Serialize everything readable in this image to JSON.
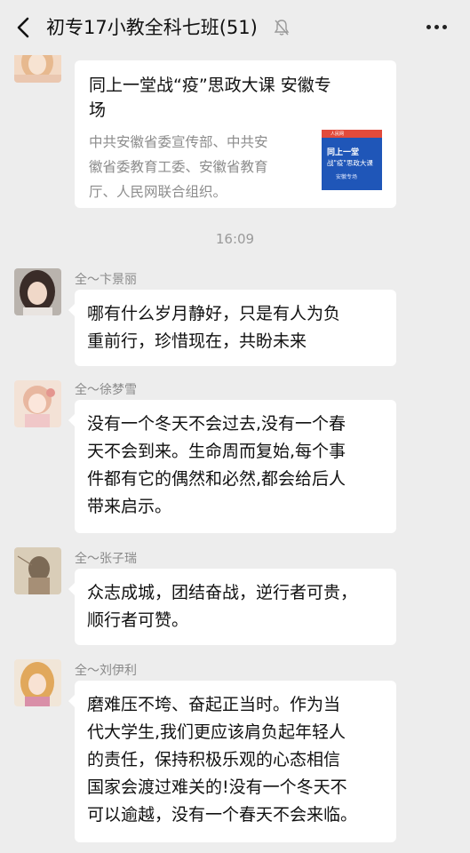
{
  "header": {
    "title": "初专17小教全科七班(51)"
  },
  "link_card": {
    "title_lines": [
      "同上一堂战“疫”思政大课 安徽专",
      "场"
    ],
    "desc_lines": [
      "中共安徽省委宣传部、中共安",
      "徽省委教育工委、安徽省教育",
      "厅、人民网联合组织。"
    ],
    "thumb": {
      "top": "人民网",
      "line1": "同上一堂",
      "line2": "战\"疫\"思政大课",
      "line3": "安徽专场"
    }
  },
  "timestamp": "16:09",
  "messages": [
    {
      "sender": "全～卞景丽",
      "lines": [
        "哪有什么岁月静好，只是有人为负",
        "重前行，珍惜现在，共盼未来"
      ]
    },
    {
      "sender": "全～徐梦雪",
      "lines": [
        "没有一个冬天不会过去,没有一个春",
        "天不会到来。生命周而复始,每个事",
        "件都有它的偶然和必然,都会给后人",
        "带来启示。"
      ]
    },
    {
      "sender": "全～张子瑞",
      "lines": [
        "众志成城，团结奋战，逆行者可贵，",
        "顺行者可赞。"
      ]
    },
    {
      "sender": "全～刘伊利",
      "lines": [
        "磨难压不垮、奋起正当时。作为当",
        "代大学生,我们更应该肩负起年轻人",
        "的责任，保持积极乐观的心态相信",
        "国家会渡过难关的!没有一个冬天不",
        "可以逾越，没有一个春天不会来临。"
      ]
    }
  ]
}
